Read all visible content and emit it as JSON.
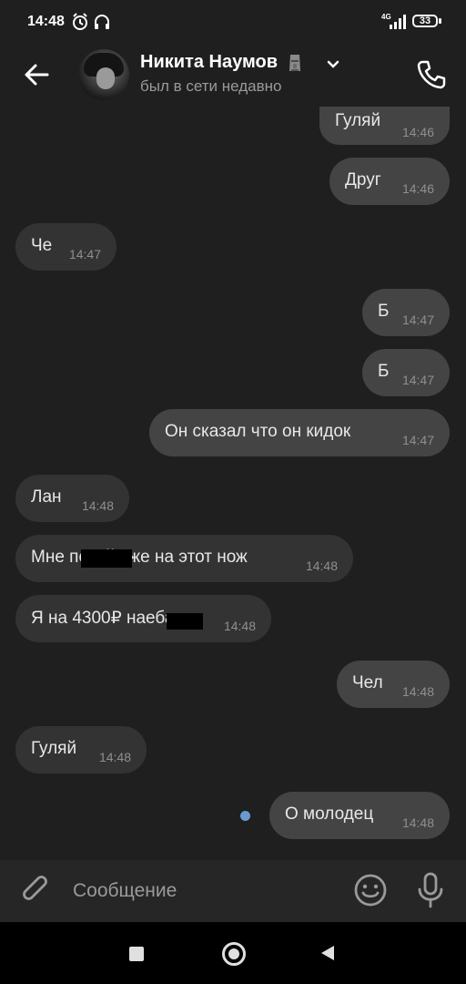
{
  "status_bar": {
    "time": "14:48",
    "network": "4G",
    "battery": "33"
  },
  "header": {
    "name": "Никита Наумов",
    "name_emoji": "moai-emoji",
    "status": "был в сети недавно"
  },
  "messages": [
    {
      "dir": "out",
      "text": "Гуляй",
      "time": "14:46"
    },
    {
      "dir": "out",
      "text": "Друг",
      "time": "14:46"
    },
    {
      "dir": "in",
      "text": "Че",
      "time": "14:47"
    },
    {
      "dir": "out",
      "text": "Б",
      "time": "14:47"
    },
    {
      "dir": "out",
      "text": "Б",
      "time": "14:47"
    },
    {
      "dir": "out",
      "text": "Он сказал что он кидок",
      "time": "14:47"
    },
    {
      "dir": "in",
      "text": "Лан",
      "time": "14:48"
    },
    {
      "dir": "in",
      "text": "Мне похуй уже на этот нож",
      "time": "14:48"
    },
    {
      "dir": "in",
      "text": "Я на 4300₽ наебал",
      "time": "14:48"
    },
    {
      "dir": "out",
      "text": "Чел",
      "time": "14:48"
    },
    {
      "dir": "in",
      "text": "Гуляй",
      "time": "14:48"
    },
    {
      "dir": "out",
      "text": "О молодец",
      "time": "14:48"
    }
  ],
  "composer": {
    "placeholder": "Сообщение"
  },
  "colors": {
    "background": "#1f1f1f",
    "incoming_bubble": "#333333",
    "outgoing_bubble": "#444444",
    "unread_dot": "#6a9bd0"
  },
  "icons": [
    "back-arrow-icon",
    "phone-icon",
    "paperclip-icon",
    "emoji-icon",
    "microphone-icon",
    "alarm-icon",
    "headphones-icon",
    "signal-icon",
    "battery-icon"
  ]
}
